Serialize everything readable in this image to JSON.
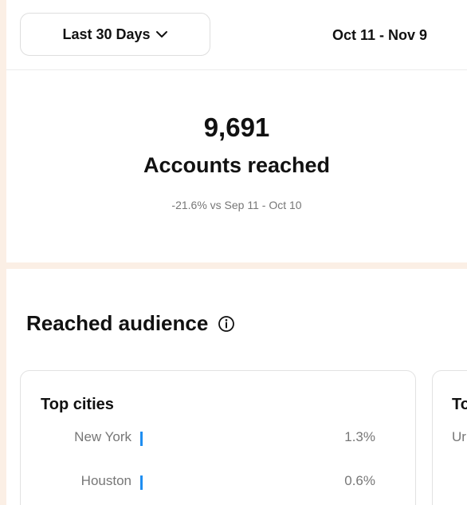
{
  "toolbar": {
    "range_label": "Last 30 Days",
    "date_range": "Oct 11 - Nov 9"
  },
  "summary": {
    "value": "9,691",
    "label": "Accounts reached",
    "comparison": "-21.6% vs Sep 11 - Oct 10"
  },
  "audience": {
    "title": "Reached audience",
    "top_cities": {
      "title": "Top cities",
      "rows": [
        {
          "name": "New York",
          "percent": "1.3%"
        },
        {
          "name": "Houston",
          "percent": "0.6%"
        }
      ]
    },
    "next_card": {
      "title": "To",
      "first_row": "Ur"
    }
  },
  "colors": {
    "accent_bar": "#1f8ef1",
    "page_background": "#fbefe5"
  }
}
